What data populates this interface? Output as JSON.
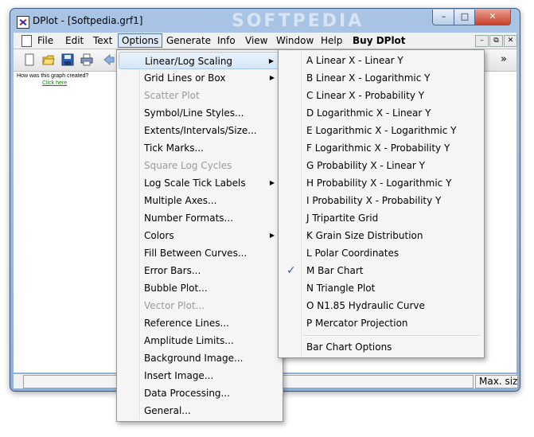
{
  "window": {
    "title": "DPlot - [Softpedia.grf1]",
    "watermark": "SOFTPEDIA",
    "buttons": {
      "minimize": "–",
      "maximize": "□",
      "close": "✕"
    }
  },
  "menubar": {
    "items": [
      {
        "label": "File"
      },
      {
        "label": "Edit"
      },
      {
        "label": "Text"
      },
      {
        "label": "Options"
      },
      {
        "label": "Generate"
      },
      {
        "label": "Info"
      },
      {
        "label": "View"
      },
      {
        "label": "Window"
      },
      {
        "label": "Help"
      },
      {
        "label": "Buy DPlot"
      }
    ],
    "mdi": {
      "minimize": "–",
      "restore": "⧉",
      "close": "✕"
    }
  },
  "toolbar": {
    "overflow": "»"
  },
  "client": {
    "question": "How was this graph created?",
    "link": "Click here"
  },
  "statusbar": {
    "right_text": "Max. siz"
  },
  "options_menu": {
    "items": [
      {
        "label": "Linear/Log Scaling",
        "submenu": true,
        "disabled": false,
        "highlighted": true
      },
      {
        "label": "Grid Lines or Box",
        "submenu": true,
        "disabled": false
      },
      {
        "label": "Scatter Plot",
        "submenu": false,
        "disabled": true
      },
      {
        "label": "Symbol/Line Styles...",
        "submenu": false,
        "disabled": false
      },
      {
        "label": "Extents/Intervals/Size...",
        "submenu": false,
        "disabled": false
      },
      {
        "label": "Tick Marks...",
        "submenu": false,
        "disabled": false
      },
      {
        "label": "Square Log Cycles",
        "submenu": false,
        "disabled": true
      },
      {
        "label": "Log Scale Tick Labels",
        "submenu": true,
        "disabled": false
      },
      {
        "label": "Multiple Axes...",
        "submenu": false,
        "disabled": false
      },
      {
        "label": "Number Formats...",
        "submenu": false,
        "disabled": false
      },
      {
        "label": "Colors",
        "submenu": true,
        "disabled": false
      },
      {
        "label": "Fill Between Curves...",
        "submenu": false,
        "disabled": false
      },
      {
        "label": "Error Bars...",
        "submenu": false,
        "disabled": false
      },
      {
        "label": "Bubble Plot...",
        "submenu": false,
        "disabled": false
      },
      {
        "label": "Vector Plot...",
        "submenu": false,
        "disabled": true
      },
      {
        "label": "Reference Lines...",
        "submenu": false,
        "disabled": false
      },
      {
        "label": "Amplitude Limits...",
        "submenu": false,
        "disabled": false
      },
      {
        "label": "Background Image...",
        "submenu": false,
        "disabled": false
      },
      {
        "label": "Insert Image...",
        "submenu": false,
        "disabled": false
      },
      {
        "label": "Data Processing...",
        "submenu": false,
        "disabled": false
      },
      {
        "label": "General...",
        "submenu": false,
        "disabled": false
      }
    ]
  },
  "scaling_submenu": {
    "items": [
      {
        "label": "A Linear X - Linear Y",
        "checked": false
      },
      {
        "label": "B Linear X - Logarithmic Y",
        "checked": false
      },
      {
        "label": "C Linear X - Probability Y",
        "checked": false
      },
      {
        "label": "D Logarithmic X - Linear Y",
        "checked": false
      },
      {
        "label": "E Logarithmic X - Logarithmic Y",
        "checked": false
      },
      {
        "label": "F Logarithmic X - Probability Y",
        "checked": false
      },
      {
        "label": "G Probability X - Linear Y",
        "checked": false
      },
      {
        "label": "H Probability X - Logarithmic Y",
        "checked": false
      },
      {
        "label": "I Probability X - Probability Y",
        "checked": false
      },
      {
        "label": "J Tripartite Grid",
        "checked": false
      },
      {
        "label": "K Grain Size Distribution",
        "checked": false
      },
      {
        "label": "L Polar Coordinates",
        "checked": false
      },
      {
        "label": "M Bar Chart",
        "checked": true
      },
      {
        "label": "N Triangle Plot",
        "checked": false
      },
      {
        "label": "O N1.85 Hydraulic Curve",
        "checked": false
      },
      {
        "label": "P Mercator Projection",
        "checked": false
      }
    ],
    "footer_item": "Bar Chart Options",
    "check_glyph": "✓"
  }
}
